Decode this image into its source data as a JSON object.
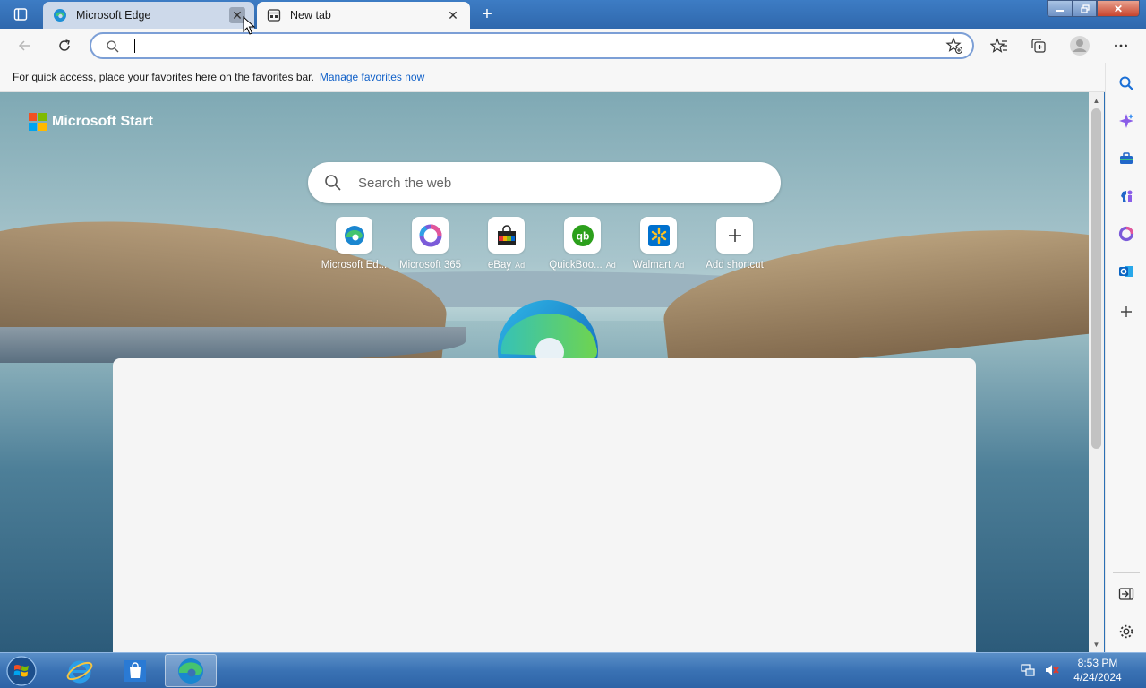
{
  "tabs": [
    {
      "label": "Microsoft Edge",
      "icon": "edge-icon"
    },
    {
      "label": "New tab",
      "icon": "newtab-page-icon"
    }
  ],
  "address_bar": {
    "value": "",
    "placeholder": ""
  },
  "favorites_bar": {
    "message": "For quick access, place your favorites here on the favorites bar.",
    "link": "Manage favorites now"
  },
  "brand": {
    "name": "Microsoft Start",
    "colors": [
      "#f25022",
      "#7fba00",
      "#00a4ef",
      "#ffb900"
    ]
  },
  "web_search": {
    "placeholder": "Search the web"
  },
  "shortcuts": [
    {
      "label": "Microsoft Ed...",
      "ad": "",
      "icon": "edge-icon"
    },
    {
      "label": "Microsoft 365",
      "ad": "",
      "icon": "m365-icon"
    },
    {
      "label": "eBay",
      "ad": "Ad",
      "icon": "ebay-bag-icon"
    },
    {
      "label": "QuickBoo...",
      "ad": "Ad",
      "icon": "quickbooks-icon"
    },
    {
      "label": "Walmart",
      "ad": "Ad",
      "icon": "walmart-icon"
    },
    {
      "label": "Add shortcut",
      "ad": "",
      "icon": "plus-icon"
    }
  ],
  "sidebar_items": [
    "search-icon",
    "copilot-icon",
    "tools-icon",
    "games-icon",
    "m365-icon",
    "outlook-icon",
    "add-icon",
    "hide-sidebar-icon",
    "settings-icon"
  ],
  "taskbar": {
    "apps": [
      "internet-explorer-icon",
      "store-icon",
      "edge-icon"
    ],
    "time": "8:53 PM",
    "date": "4/24/2024"
  },
  "colors": {
    "accent": "#1060c8",
    "taskbar": "#3a72b4",
    "titlebar": "#2f68ad"
  }
}
